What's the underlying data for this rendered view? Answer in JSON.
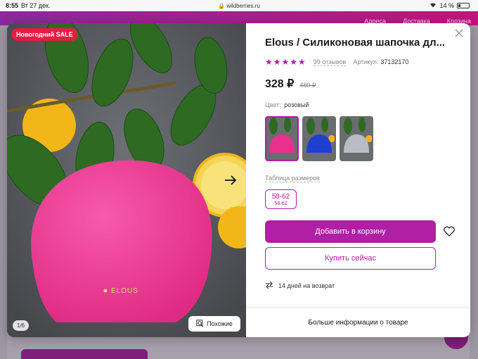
{
  "status_bar": {
    "time": "8:55",
    "date": "Вт 27 дек.",
    "url": "wildberries.ru",
    "battery": "14 %"
  },
  "site_nav": {
    "items": [
      "Адреса",
      "Доставка",
      "Корзина"
    ]
  },
  "gallery": {
    "sale_badge": "Новогодний SALE",
    "counter": "1/6",
    "similar_label": "Похожие",
    "brand_on_cap": "ELOUS"
  },
  "product": {
    "title": "Elous / Силиконовая шапочка дл...",
    "rating_stars": "★★★★★",
    "reviews": "99 отзывов",
    "sku_label": "Артикул:",
    "sku_value": "37132170",
    "price": "328 ₽",
    "old_price": "480 ₽",
    "color_label": "Цвет:",
    "color_value": "розовый",
    "swatches": [
      {
        "color": "#e8308d",
        "selected": true
      },
      {
        "color": "#1f3fd1",
        "selected": false
      },
      {
        "color": "#b9bcc2",
        "selected": false
      }
    ],
    "size_table": "Таблица размеров",
    "size_main": "58-62",
    "size_sub": "58-62",
    "add_to_cart": "Добавить в корзину",
    "buy_now": "Купить сейчас",
    "return_policy": "14 дней на возврат",
    "more_info": "Больше информации о товаре"
  },
  "colors": {
    "accent": "#b01fa5",
    "sale": "#e21e42",
    "cap": "#ee3c94"
  }
}
